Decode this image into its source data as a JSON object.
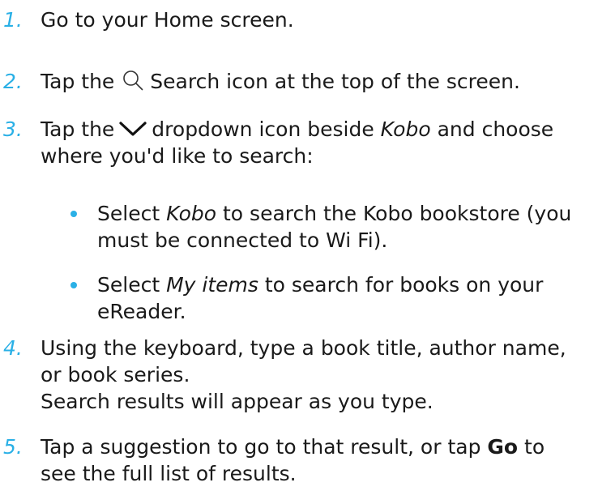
{
  "steps": [
    {
      "num": "1.",
      "text": "Go to your Home screen."
    },
    {
      "num": "2.",
      "before": "Tap the",
      "after": "Search icon at the top of the screen.",
      "icon": "search-icon"
    },
    {
      "num": "3.",
      "before": "Tap the",
      "mid": "dropdown icon beside",
      "em": "Kobo",
      "after": "and choose",
      "line2": "where you'd like to search:",
      "icon": "chevron-down-icon"
    },
    {
      "num": "4.",
      "line1": "Using the keyboard, type a book title, author name,",
      "line2": "or book series.",
      "line3": "Search results will appear as you type."
    },
    {
      "num": "5.",
      "before": "Tap a suggestion to go to that result, or tap",
      "bold": "Go",
      "after": "to",
      "line2": "see the full list of results."
    }
  ],
  "bullets": [
    {
      "before": "Select",
      "em": "Kobo",
      "after": "to search the Kobo bookstore (you",
      "line2": "must be connected to Wi Fi)."
    },
    {
      "before": "Select",
      "em": "My items",
      "after": "to search for books on your",
      "line2": "eReader."
    }
  ],
  "colors": {
    "accent": "#2ab0e6",
    "text": "#1a1a1a"
  }
}
